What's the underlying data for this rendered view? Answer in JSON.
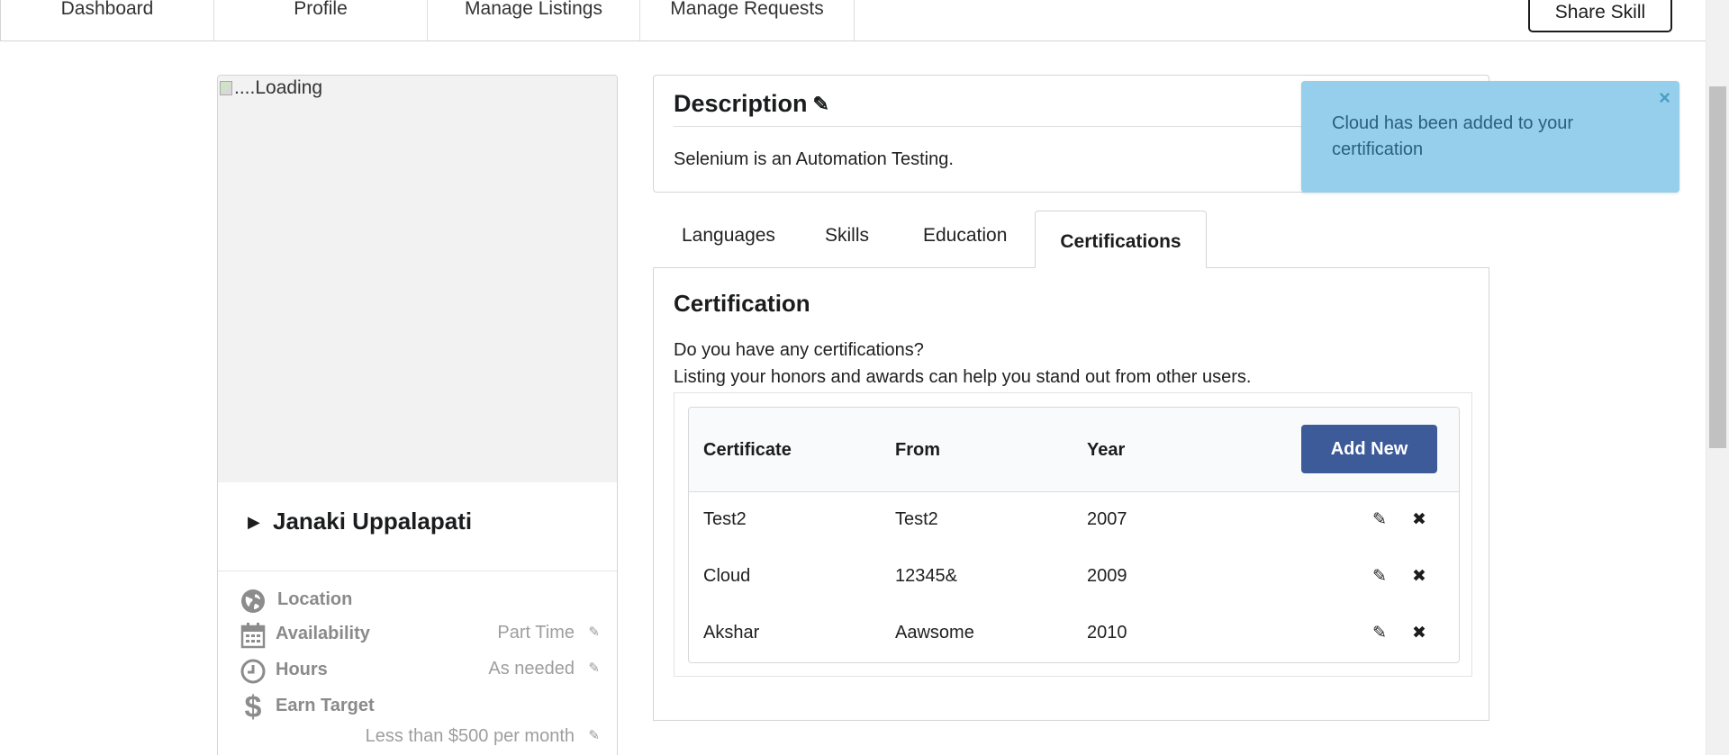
{
  "nav": {
    "items": [
      {
        "label": "Dashboard"
      },
      {
        "label": "Profile"
      },
      {
        "label": "Manage Listings"
      },
      {
        "label": "Manage Requests"
      }
    ],
    "share_label": "Share Skill"
  },
  "profile": {
    "photo_alt": "....Loading",
    "name": "Janaki Uppalapati",
    "location_label": "Location",
    "availability_label": "Availability",
    "availability_value": "Part Time",
    "hours_label": "Hours",
    "hours_value": "As needed",
    "earn_label": "Earn Target",
    "earn_value": "Less than $500 per month"
  },
  "description": {
    "title": "Description",
    "text": "Selenium is an Automation Testing."
  },
  "toast": {
    "message": "Cloud has been added to your certification",
    "close": "×"
  },
  "tabs": [
    {
      "label": "Languages"
    },
    {
      "label": "Skills"
    },
    {
      "label": "Education"
    },
    {
      "label": "Certifications"
    }
  ],
  "certification": {
    "title": "Certification",
    "question": "Do you have any certifications?",
    "subtitle": "Listing your honors and awards can help you stand out from other users.",
    "headers": {
      "certificate": "Certificate",
      "from": "From",
      "year": "Year"
    },
    "add_label": "Add New",
    "rows": [
      {
        "certificate": "Test2",
        "from": "Test2",
        "year": "2007"
      },
      {
        "certificate": "Cloud",
        "from": "12345&",
        "year": "2009"
      },
      {
        "certificate": "Akshar",
        "from": "Aawsome",
        "year": "2010"
      }
    ]
  },
  "icons": {
    "pencil": "✎",
    "close": "✖",
    "globe": "globe-icon",
    "calendar": "calendar-icon",
    "clock": "clock-icon",
    "dollar": "$"
  }
}
